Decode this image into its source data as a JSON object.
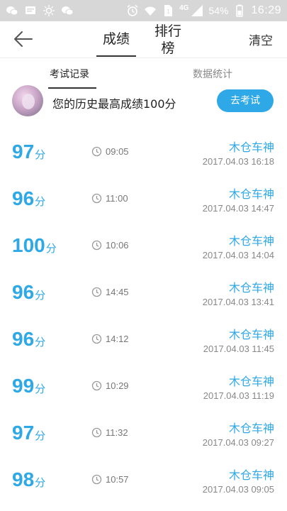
{
  "status_bar": {
    "network_label": "4G",
    "battery": "54%",
    "time": "16:29"
  },
  "nav": {
    "tab_score": "成绩",
    "tab_rank_line1": "排行",
    "tab_rank_line2": "榜",
    "clear": "清空"
  },
  "sub_tabs": {
    "records": "考试记录",
    "stats": "数据统计"
  },
  "best": {
    "text": "您的历史最高成绩100分",
    "button": "去考试"
  },
  "records": [
    {
      "score": "97",
      "unit": "分",
      "duration": "09:05",
      "user": "木仓车神",
      "date": "2017.04.03  16:18"
    },
    {
      "score": "96",
      "unit": "分",
      "duration": "11:00",
      "user": "木仓车神",
      "date": "2017.04.03  14:47"
    },
    {
      "score": "100",
      "unit": "分",
      "duration": "10:06",
      "user": "木仓车神",
      "date": "2017.04.03  14:04"
    },
    {
      "score": "96",
      "unit": "分",
      "duration": "14:45",
      "user": "木仓车神",
      "date": "2017.04.03  13:41"
    },
    {
      "score": "96",
      "unit": "分",
      "duration": "14:12",
      "user": "木仓车神",
      "date": "2017.04.03  11:45"
    },
    {
      "score": "99",
      "unit": "分",
      "duration": "10:29",
      "user": "木仓车神",
      "date": "2017.04.03  11:19"
    },
    {
      "score": "97",
      "unit": "分",
      "duration": "11:32",
      "user": "木仓车神",
      "date": "2017.04.03  09:27"
    },
    {
      "score": "98",
      "unit": "分",
      "duration": "10:57",
      "user": "木仓车神",
      "date": "2017.04.03  09:05"
    }
  ],
  "colors": {
    "accent": "#2ea8e6",
    "status_bar": "#d7d7d7"
  },
  "icons": {
    "back": "back-arrow-icon",
    "clock": "clock-icon"
  }
}
